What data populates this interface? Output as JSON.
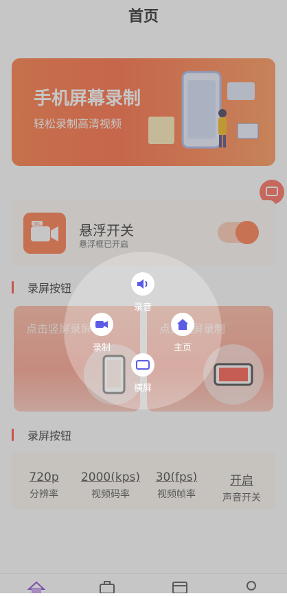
{
  "header": {
    "title": "首页"
  },
  "banner": {
    "title": "手机屏幕录制",
    "subtitle": "轻松录制高清视频"
  },
  "float_card": {
    "title": "悬浮开关",
    "subtitle": "悬浮框已开启",
    "rec_badge": "REC",
    "toggle_on": true
  },
  "sections": {
    "record_buttons_1": "录屏按钮",
    "record_buttons_2": "录屏按钮"
  },
  "record_cards": [
    {
      "label": "点击竖屏录屏"
    },
    {
      "label": "点击横屏录制"
    }
  ],
  "settings": [
    {
      "value": "720p",
      "label": "分辨率"
    },
    {
      "value": "2000(kps)",
      "label": "视频码率"
    },
    {
      "value": "30(fps)",
      "label": "视频帧率"
    },
    {
      "value": "开启",
      "label": "声音开关"
    }
  ],
  "radial_menu": {
    "sound": "录音",
    "record": "录制",
    "home": "主页",
    "landscape": "横屏"
  },
  "colors": {
    "accent": "#ff5a2a",
    "icon_purple": "#5b5be6"
  },
  "nav_icons": [
    "home-icon",
    "briefcase-icon",
    "calendar-icon",
    "profile-icon"
  ]
}
